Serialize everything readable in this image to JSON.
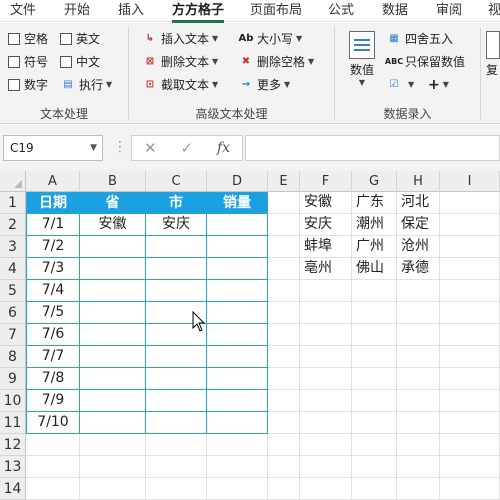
{
  "tabs": [
    "文件",
    "开始",
    "插入",
    "方方格子",
    "页面布局",
    "公式",
    "数据",
    "审阅",
    "视"
  ],
  "active_tab_index": 3,
  "ribbon": {
    "text_group": {
      "checkboxes": [
        "空格",
        "英文",
        "符号",
        "中文",
        "数字"
      ],
      "execute": "执行",
      "label": "文本处理"
    },
    "adv_group": {
      "insert_text": "插入文本",
      "delete_text": "删除文本",
      "extract_text": "截取文本",
      "case": "大小写",
      "delete_space": "删除空格",
      "more": "更多",
      "label": "高级文本处理"
    },
    "data_group": {
      "value": "数值",
      "round": "四舍五入",
      "keep_value": "只保留数值",
      "plus": "+",
      "label": "数据录入",
      "partial": "复"
    }
  },
  "formula_bar": {
    "namebox": "C19",
    "cancel": "✕",
    "confirm": "✓",
    "fx": "fx",
    "value": ""
  },
  "columns": [
    "A",
    "B",
    "C",
    "D",
    "E",
    "F",
    "G",
    "H",
    "I"
  ],
  "rows": [
    "1",
    "2",
    "3",
    "4",
    "5",
    "6",
    "7",
    "8",
    "9",
    "10",
    "11",
    "12",
    "13",
    "14"
  ],
  "table": {
    "headers": [
      "日期",
      "省",
      "市",
      "销量"
    ],
    "rows": [
      [
        "7/1",
        "安徽",
        "安庆",
        ""
      ],
      [
        "7/2",
        "",
        "",
        ""
      ],
      [
        "7/3",
        "",
        "",
        ""
      ],
      [
        "7/4",
        "",
        "",
        ""
      ],
      [
        "7/5",
        "",
        "",
        ""
      ],
      [
        "7/6",
        "",
        "",
        ""
      ],
      [
        "7/7",
        "",
        "",
        ""
      ],
      [
        "7/8",
        "",
        "",
        ""
      ],
      [
        "7/9",
        "",
        "",
        ""
      ],
      [
        "7/10",
        "",
        "",
        ""
      ]
    ]
  },
  "lookup": [
    [
      "安徽",
      "广东",
      "河北"
    ],
    [
      "安庆",
      "潮州",
      "保定"
    ],
    [
      "蚌埠",
      "广州",
      "沧州"
    ],
    [
      "亳州",
      "佛山",
      "承德"
    ]
  ],
  "colors": {
    "header_bg": "#1ba1e2",
    "table_border": "#27a3d6",
    "accent": "#217346"
  }
}
